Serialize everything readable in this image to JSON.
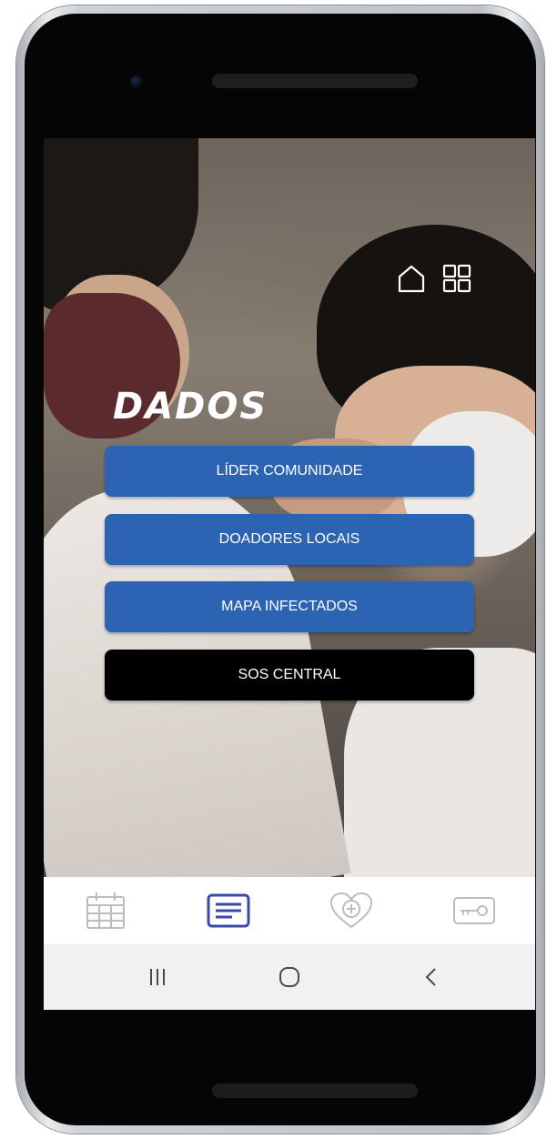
{
  "screen": {
    "title": "DADOS",
    "menu": [
      {
        "label": "LÍDER COMUNIDADE",
        "color": "#2d63b3"
      },
      {
        "label": "DOADORES LOCAIS",
        "color": "#2d63b3"
      },
      {
        "label": "MAPA INFECTADOS",
        "color": "#2d63b3"
      },
      {
        "label": "SOS CENTRAL",
        "color": "#000000"
      }
    ],
    "top_icons": [
      "home-icon",
      "grid-icon"
    ]
  },
  "bottom_nav": {
    "items": [
      {
        "icon": "calendar-icon",
        "active": false
      },
      {
        "icon": "document-icon",
        "active": true
      },
      {
        "icon": "heart-plus-icon",
        "active": false
      },
      {
        "icon": "key-icon",
        "active": false
      }
    ],
    "active_color": "#3949a8",
    "inactive_color": "#bdbdbd"
  },
  "system_nav": [
    "recent-apps-icon",
    "home-circle-icon",
    "back-icon"
  ]
}
